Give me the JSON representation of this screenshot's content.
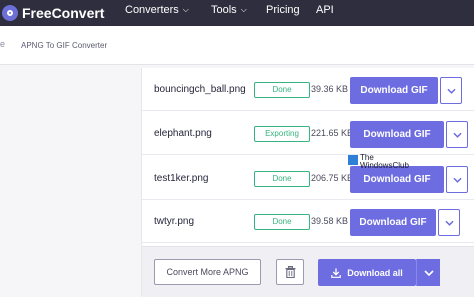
{
  "header": {
    "brand": "FreeConvert",
    "nav": [
      {
        "label": "Converters",
        "has_caret": true
      },
      {
        "label": "Tools",
        "has_caret": true
      },
      {
        "label": "Pricing",
        "has_caret": false
      },
      {
        "label": "API",
        "has_caret": false
      }
    ]
  },
  "breadcrumb": {
    "separator": "e",
    "current": "APNG To GIF Converter"
  },
  "files": [
    {
      "name": "bouncingch_ball.png",
      "status": "Done",
      "size": "39.36 KB",
      "button": "Download GIF"
    },
    {
      "name": "elephant.png",
      "status": "Exporting",
      "size": "221.65 KB",
      "button": "Download GIF"
    },
    {
      "name": "test1ker.png",
      "status": "Done",
      "size": "206.75 KB",
      "button": "Download GIF"
    },
    {
      "name": "twtyr.png",
      "status": "Done",
      "size": "39.58 KB",
      "button": "Download GIF"
    }
  ],
  "footer": {
    "convert_more": "Convert More APNG",
    "download_all": "Download all"
  },
  "watermark": {
    "line1": "The",
    "line2": "WindowsClub"
  },
  "colors": {
    "header_bg": "#2e2e3e",
    "accent": "#6d6ce0",
    "done_green": "#36b37e"
  },
  "icons": {
    "logo": "freeconvert-logo-icon",
    "caret": "chevron-down-icon",
    "trash": "trash-icon",
    "download": "download-icon"
  }
}
